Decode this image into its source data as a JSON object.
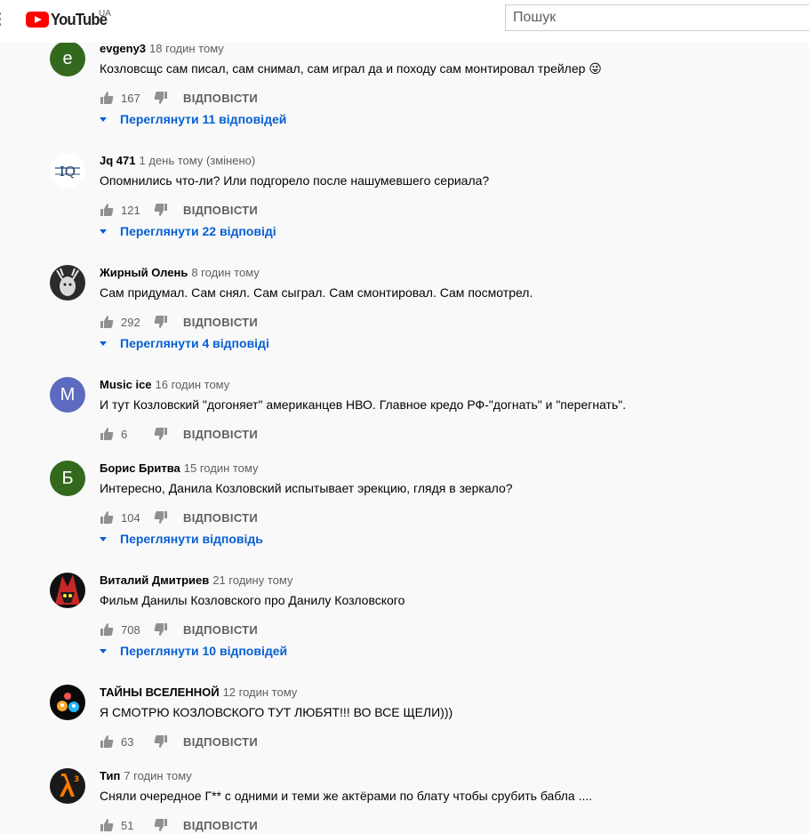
{
  "header": {
    "logo_text": "YouTube",
    "country": "UA",
    "search_placeholder": "Пошук"
  },
  "colors": {
    "link_blue": "#065fd4",
    "brand_red": "#ff0000",
    "secondary_text": "#606060"
  },
  "comments": [
    {
      "author": "evgeny3",
      "time": "18 годин тому",
      "text": "Козловсщс сам писал, сам снимал, сам играл да и походу сам монтировал трейлер 😜",
      "likes": "167",
      "reply_label": "ВІДПОВІСТИ",
      "replies_label": "Переглянути 11 відповідей",
      "avatar_letter": "e",
      "avatar_color": "#33691e"
    },
    {
      "author": "Jq 471",
      "time": "1 день тому (змінено)",
      "text": "Опомнились что-ли? Или подгорело после нашумевшего сериала?",
      "likes": "121",
      "reply_label": "ВІДПОВІСТИ",
      "replies_label": "Переглянути 22 відповіді",
      "avatar_letter": "IQ",
      "avatar_color": "#ffffff"
    },
    {
      "author": "Жирный Олень",
      "time": "8 годин тому",
      "text": "Сам придумал. Сам снял. Сам сыграл. Сам смонтировал. Сам посмотрел.",
      "likes": "292",
      "reply_label": "ВІДПОВІСТИ",
      "replies_label": "Переглянути 4 відповіді",
      "avatar_letter": "",
      "avatar_color": "#3a3a3a"
    },
    {
      "author": "Music ice",
      "time": "16 годин тому",
      "text": "И тут Козловский \"догоняет\" американцев НВО. Главное кредо РФ-\"догнать\" и \"перегнать\".",
      "likes": "6",
      "reply_label": "ВІДПОВІСТИ",
      "replies_label": "",
      "avatar_letter": "M",
      "avatar_color": "#5c6bc0"
    },
    {
      "author": "Борис Бритва",
      "time": "15 годин тому",
      "text": "Интересно, Данила Козловский испытывает эрекцию, глядя в зеркало?",
      "likes": "104",
      "reply_label": "ВІДПОВІСТИ",
      "replies_label": "Переглянути відповідь",
      "avatar_letter": "Б",
      "avatar_color": "#33691e"
    },
    {
      "author": "Виталий Дмитриев",
      "time": "21 годину тому",
      "text": "Фильм Данилы Козловского про Данилу Козловского",
      "likes": "708",
      "reply_label": "ВІДПОВІСТИ",
      "replies_label": "Переглянути 10 відповідей",
      "avatar_letter": "",
      "avatar_color": "#b71c1c"
    },
    {
      "author": "ТАЙНЫ ВСЕЛЕННОЙ",
      "time": "12 годин тому",
      "text": "Я СМОТРЮ КОЗЛОВСКОГО ТУТ ЛЮБЯТ!!! ВО ВСЕ ЩЕЛИ)))",
      "likes": "63",
      "reply_label": "ВІДПОВІСТИ",
      "replies_label": "",
      "avatar_letter": "",
      "avatar_color": "#0d0d0d"
    },
    {
      "author": "Тип",
      "time": "7 годин тому",
      "text": "Сняли очередное Г** с одними и теми же актёрами по блату чтобы срубить бабла ....",
      "likes": "51",
      "reply_label": "ВІДПОВІСТИ",
      "replies_label": "",
      "avatar_letter": "λ³",
      "avatar_color": "#1a1a1a"
    }
  ]
}
